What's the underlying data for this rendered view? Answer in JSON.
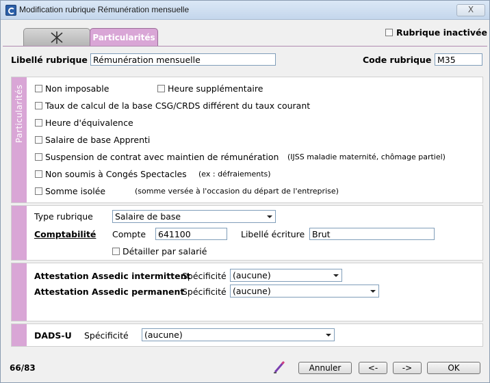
{
  "window": {
    "title": "Modification rubrique Rémunération mensuelle",
    "close_label": "X"
  },
  "tabs": {
    "particularites": "Particularités"
  },
  "rubrique_inactivee": {
    "label": "Rubrique inactivée",
    "checked": false
  },
  "header": {
    "libelle_label": "Libellé rubrique",
    "libelle_value": "Rémunération mensuelle",
    "code_label": "Code rubrique",
    "code_value": "M35"
  },
  "particularites": {
    "section_label": "Particularités",
    "non_imposable": "Non imposable",
    "heure_supp": "Heure supplémentaire",
    "taux_csg": "Taux de calcul de la base CSG/CRDS différent du taux courant",
    "heure_equiv": "Heure d'équivalence",
    "salaire_apprenti": "Salaire de base Apprenti",
    "suspension": "Suspension de contrat avec maintien de rémunération",
    "suspension_note": "(IJSS maladie maternité, chômage partiel)",
    "conges_spectacles": "Non soumis à Congés Spectacles",
    "conges_note": "(ex : défraiements)",
    "somme_isolee": "Somme isolée",
    "somme_note": "(somme versée à l'occasion du départ de l'entreprise)"
  },
  "compta": {
    "type_label": "Type rubrique",
    "type_value": "Salaire de base",
    "comptabilite_label": "Comptabilité",
    "compte_label": "Compte",
    "compte_value": "641100",
    "libelle_ecriture_label": "Libellé écriture",
    "libelle_ecriture_value": "Brut",
    "detailler_label": "Détailler par salarié"
  },
  "assedic": {
    "intermittent_label": "Attestation Assedic intermittent",
    "permanent_label": "Attestation Assedic permanent",
    "specificite_label": "Spécificité",
    "intermittent_value": "(aucune)",
    "permanent_value": "(aucune)"
  },
  "dads": {
    "label": "DADS-U",
    "specificite_label": "Spécificité",
    "value": "(aucune)"
  },
  "footer": {
    "record_counter": "66/83",
    "annuler": "Annuler",
    "prev": "<-",
    "next": "->",
    "ok": "OK"
  },
  "colors": {
    "accent": "#d9a6d6",
    "titlebar": "#c4d6ec"
  }
}
